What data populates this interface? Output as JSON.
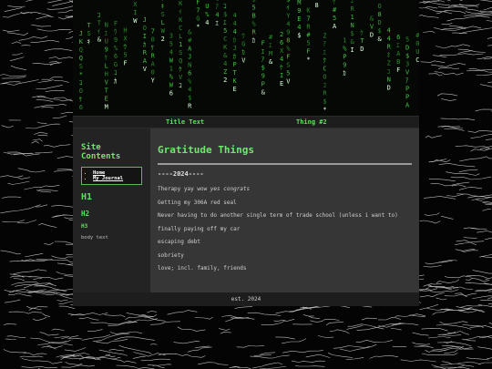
{
  "nav": {
    "links": [
      "Title Text",
      "Thing #2"
    ]
  },
  "sidebar": {
    "title": "Site Contents",
    "links": [
      "Home",
      "My Journal"
    ],
    "samples": {
      "h1": "H1",
      "h2": "H2",
      "h3": "H3",
      "body": "body text"
    }
  },
  "main": {
    "title": "Gratitude Things",
    "year": "----2024----",
    "entries": [
      {
        "plain": "Therapy yay wow ",
        "emph": "yes congrats"
      },
      {
        "plain": "Getting my 306A red seal",
        "emph": ""
      },
      {
        "plain": "Never having to do another single term of trade school (unless i want to)",
        "emph": ""
      },
      {
        "plain": "finally paying off my car",
        "emph": ""
      },
      {
        "plain": "escaping debt",
        "emph": ""
      },
      {
        "plain": "sobriety",
        "emph": ""
      },
      {
        "plain": "love; incl. family, friends",
        "emph": ""
      }
    ]
  },
  "footer": {
    "text": "est. 2024"
  },
  "colors": {
    "accent_green": "#5fe05f",
    "main_bg": "#363636",
    "sidebar_bg": "#232323",
    "bar_bg": "#1d1d1d"
  }
}
